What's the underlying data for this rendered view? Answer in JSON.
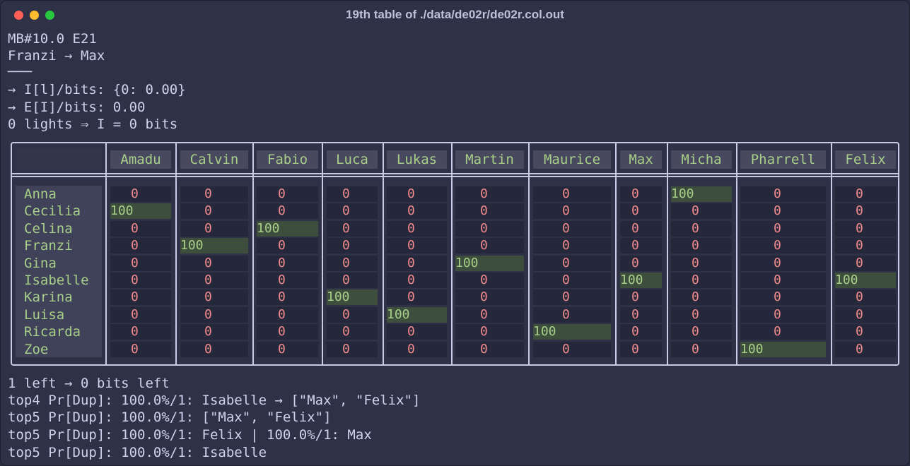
{
  "window": {
    "title": "19th table of ./data/de02r/de02r.col.out"
  },
  "header_lines": [
    "MB#10.0 E21",
    "Franzi → Max",
    "───",
    "→ I[l]/bits: {0: 0.00}",
    "→ E[I]/bits: 0.00",
    "0 lights ⇒ I = 0 bits"
  ],
  "table": {
    "columns": [
      "Amadu",
      "Calvin",
      "Fabio",
      "Luca",
      "Lukas",
      "Martin",
      "Maurice",
      "Max",
      "Micha",
      "Pharrell",
      "Felix"
    ],
    "rows": [
      {
        "name": "Anna",
        "values": [
          "0",
          "0",
          "0",
          "0",
          "0",
          "0",
          "0",
          "0",
          "100",
          "0",
          "0"
        ]
      },
      {
        "name": "Cecilia",
        "values": [
          "100",
          "0",
          "0",
          "0",
          "0",
          "0",
          "0",
          "0",
          "0",
          "0",
          "0"
        ]
      },
      {
        "name": "Celina",
        "values": [
          "0",
          "0",
          "100",
          "0",
          "0",
          "0",
          "0",
          "0",
          "0",
          "0",
          "0"
        ]
      },
      {
        "name": "Franzi",
        "values": [
          "0",
          "100",
          "0",
          "0",
          "0",
          "0",
          "0",
          "0",
          "0",
          "0",
          "0"
        ]
      },
      {
        "name": "Gina",
        "values": [
          "0",
          "0",
          "0",
          "0",
          "0",
          "100",
          "0",
          "0",
          "0",
          "0",
          "0"
        ]
      },
      {
        "name": "Isabelle",
        "values": [
          "0",
          "0",
          "0",
          "0",
          "0",
          "0",
          "0",
          "100",
          "0",
          "0",
          "100"
        ]
      },
      {
        "name": "Karina",
        "values": [
          "0",
          "0",
          "0",
          "100",
          "0",
          "0",
          "0",
          "0",
          "0",
          "0",
          "0"
        ]
      },
      {
        "name": "Luisa",
        "values": [
          "0",
          "0",
          "0",
          "0",
          "100",
          "0",
          "0",
          "0",
          "0",
          "0",
          "0"
        ]
      },
      {
        "name": "Ricarda",
        "values": [
          "0",
          "0",
          "0",
          "0",
          "0",
          "0",
          "100",
          "0",
          "0",
          "0",
          "0"
        ]
      },
      {
        "name": "Zoe",
        "values": [
          "0",
          "0",
          "0",
          "0",
          "0",
          "0",
          "0",
          "0",
          "0",
          "100",
          "0"
        ]
      }
    ]
  },
  "footer_lines": [
    "1 left → 0 bits left",
    "top4 Pr[Dup]: 100.0%/1: Isabelle → [\"Max\", \"Felix\"]",
    "top5 Pr[Dup]: 100.0%/1: [\"Max\", \"Felix\"]",
    "top5 Pr[Dup]: 100.0%/1: Felix | 100.0%/1: Max",
    "top5 Pr[Dup]: 100.0%/1: Isabelle"
  ],
  "colors": {
    "background": "#2f3146",
    "text": "#ced2ec",
    "name_green": "#a8cf89",
    "zero_red": "#f08a8c",
    "highlight_bg": "#3d4f3c",
    "border": "#c8cbe6"
  }
}
